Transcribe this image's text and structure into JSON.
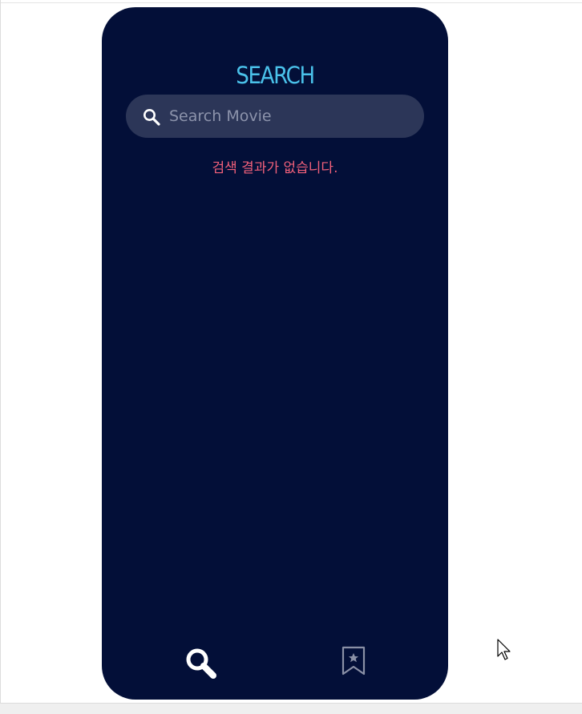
{
  "page": {
    "title": "SEARCH"
  },
  "search": {
    "placeholder": "Search Movie",
    "value": ""
  },
  "results": {
    "empty_message": "검색 결과가 없습니다."
  },
  "nav": {
    "items": [
      {
        "name": "search",
        "icon": "search-icon",
        "active": true
      },
      {
        "name": "bookmark",
        "icon": "bookmark-star-icon",
        "active": false
      }
    ]
  },
  "colors": {
    "background": "#030f38",
    "title": "#4ac1ea",
    "search_box": "#2c3658",
    "empty_message": "#f1607a",
    "nav_active": "#ffffff",
    "nav_inactive": "#8a90a6"
  }
}
